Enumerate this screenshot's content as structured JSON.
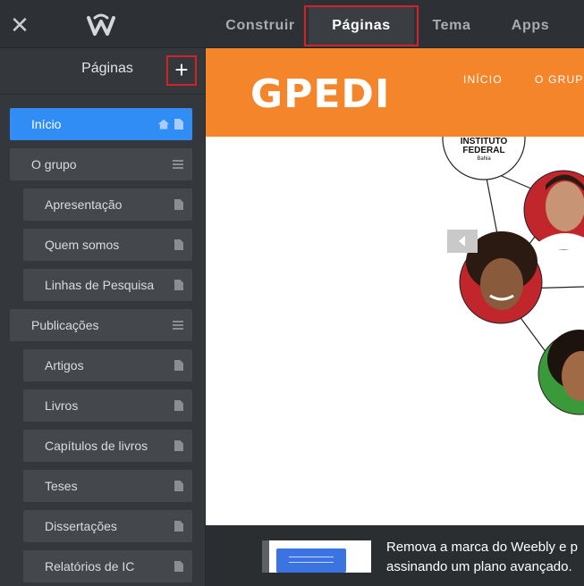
{
  "topbar": {
    "close_label": "✕",
    "tabs": [
      {
        "label": "Construir"
      },
      {
        "label": "Páginas"
      },
      {
        "label": "Tema"
      },
      {
        "label": "Apps"
      }
    ]
  },
  "sidebar": {
    "title": "Páginas",
    "add_label": "+",
    "pages": [
      {
        "label": "Início"
      },
      {
        "label": "O grupo"
      },
      {
        "label": "Apresentação"
      },
      {
        "label": "Quem somos"
      },
      {
        "label": "Linhas de Pesquisa"
      },
      {
        "label": "Publicações"
      },
      {
        "label": "Artigos"
      },
      {
        "label": "Livros"
      },
      {
        "label": "Capítulos de livros"
      },
      {
        "label": "Teses"
      },
      {
        "label": "Dissertações"
      },
      {
        "label": "Relatórios de IC"
      }
    ]
  },
  "preview": {
    "site_title": "GPEDI",
    "nav": [
      "INÍCIO",
      "O GRUPO"
    ],
    "logo_lines": [
      "INSTITUTO",
      "FEDERAL",
      "Bahia"
    ],
    "accent_color": "#f5852a"
  },
  "banner": {
    "line1": "Remova a marca do Weebly e p",
    "line2": "assinando um plano avançado."
  },
  "colors": {
    "selected": "#2f8df5",
    "highlight_box": "#d0232a"
  }
}
